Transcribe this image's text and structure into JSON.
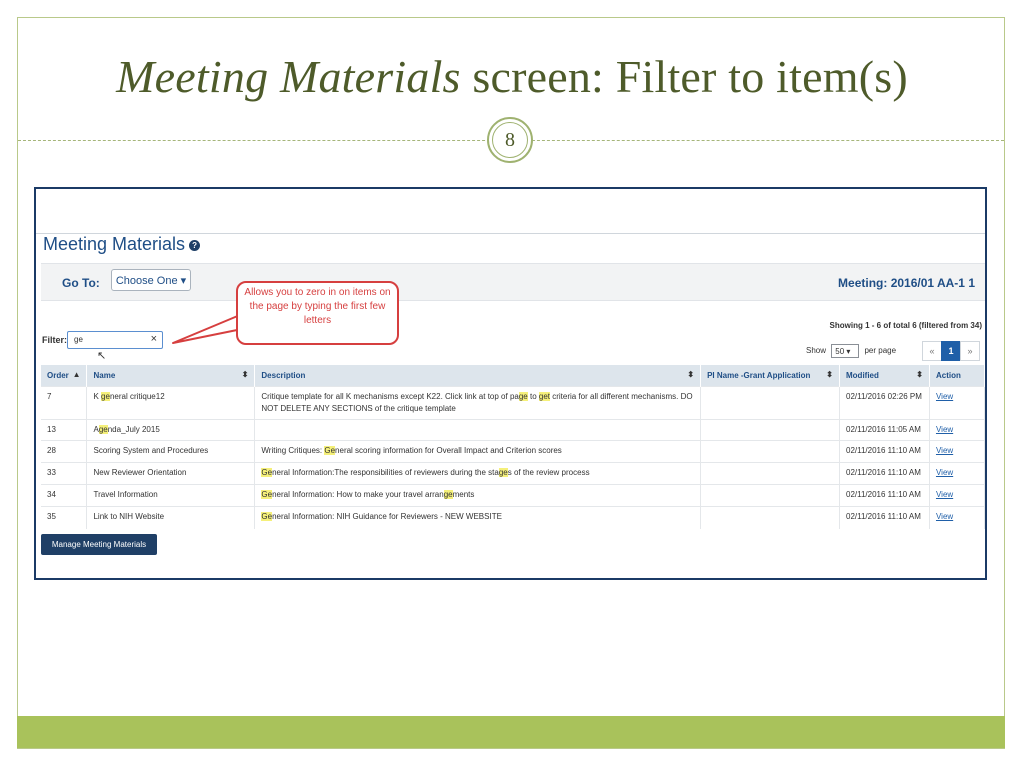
{
  "slide": {
    "title_italic": "Meeting Materials",
    "title_rest": " screen: Filter to item(s)",
    "page_number": "8"
  },
  "app": {
    "heading": "Meeting Materials",
    "help_icon": "help-circle-icon",
    "goto_label": "Go To:",
    "goto_button": "Choose One ▾",
    "meeting": "Meeting: 2016/01 AA-1 1",
    "filter_label": "Filter:",
    "filter_value": "ge",
    "filter_clear": "×",
    "showing": "Showing 1 - 6 of total 6 (filtered from 34)",
    "show_label": "Show",
    "per_page_value": "50",
    "per_page_label": "per page",
    "pager": [
      "«",
      "1",
      "»"
    ],
    "manage_button": "Manage Meeting Materials"
  },
  "callout": {
    "text": "Allows you to zero in on items on the page by typing the first few letters"
  },
  "table": {
    "headers": [
      "Order",
      "Name",
      "Description",
      "PI Name -Grant Application",
      "Modified",
      "Action"
    ],
    "rows": [
      {
        "order": "7",
        "name": [
          [
            "K "
          ],
          [
            "ge",
            true
          ],
          [
            "neral critique12"
          ]
        ],
        "desc": [
          [
            "Critique template for all K mechanisms except K22. Click link at top of pa"
          ],
          [
            "ge",
            true
          ],
          [
            " to "
          ],
          [
            "get",
            true
          ],
          [
            " criteria for all different mechanisms. DO NOT DELETE ANY SECTIONS of the critique template"
          ]
        ],
        "pi": "",
        "modified": "02/11/2016 02:26 PM",
        "action": "View"
      },
      {
        "order": "13",
        "name": [
          [
            "A"
          ],
          [
            "ge",
            true
          ],
          [
            "nda_July 2015"
          ]
        ],
        "desc": [],
        "pi": "",
        "modified": "02/11/2016 11:05 AM",
        "action": "View"
      },
      {
        "order": "28",
        "name": [
          [
            "Scoring System and Procedures"
          ]
        ],
        "desc": [
          [
            "Writing Critiques: "
          ],
          [
            "Ge",
            true
          ],
          [
            "neral scoring information for Overall Impact and Criterion scores"
          ]
        ],
        "pi": "",
        "modified": "02/11/2016 11:10 AM",
        "action": "View"
      },
      {
        "order": "33",
        "name": [
          [
            "New Reviewer Orientation"
          ]
        ],
        "desc": [
          [
            "Ge",
            true
          ],
          [
            "neral Information:The responsibilities of reviewers during the sta"
          ],
          [
            "ge",
            true
          ],
          [
            "s of the review process"
          ]
        ],
        "pi": "",
        "modified": "02/11/2016 11:10 AM",
        "action": "View"
      },
      {
        "order": "34",
        "name": [
          [
            "Travel Information"
          ]
        ],
        "desc": [
          [
            "Ge",
            true
          ],
          [
            "neral Information: How to make your travel arran"
          ],
          [
            "ge",
            true
          ],
          [
            "ments"
          ]
        ],
        "pi": "",
        "modified": "02/11/2016 11:10 AM",
        "action": "View"
      },
      {
        "order": "35",
        "name": [
          [
            "Link to NIH Website"
          ]
        ],
        "desc": [
          [
            "Ge",
            true
          ],
          [
            "neral Information: NIH Guidance for Reviewers - NEW WEBSITE"
          ]
        ],
        "pi": "",
        "modified": "02/11/2016 11:10 AM",
        "action": "View"
      }
    ]
  },
  "colors": {
    "title": "#4e5b2a",
    "footer": "#a9c25b",
    "link": "#1f5fa8",
    "callout": "#d63f3f",
    "highlight": "#f5f07a"
  }
}
